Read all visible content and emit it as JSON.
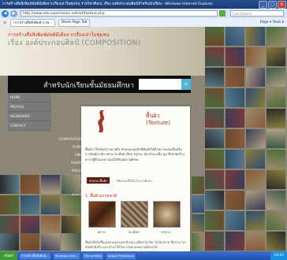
{
  "window": {
    "title": "การสร้างสื่อสิ่งพิมพ์มัลติมีเดียจากเรื่องเล่าในชุมชน รายวิชาศิลปะ เรื่อง องค์ประกอบศิลป์สำหรับนักเรียน - Windows Internet Explorer",
    "minimize": "_",
    "maximize": "□",
    "close": "×"
  },
  "address": {
    "url": "http://www.edu-supervision.net/art/texture.php",
    "search_placeholder": "Live Search"
  },
  "tabs": {
    "tab1": "การสร้างสื่อสิ่งพิมพ์ ภาพ...",
    "tab2": "Blank Page Tab",
    "tools": "Page ▾  Tools ▾"
  },
  "site": {
    "header_line1": "การสร้างสื่อสิ่งพิมพ์มัลติมีเดียจากเรื่องเล่าในชุมชน",
    "header_line2": "เรื่อง องค์ประกอบศิลป์ (COMPOSITION)",
    "band_title": "สำหรับนักเรียนชั้นมัธยมศึกษา",
    "search_icon": "search-icon",
    "nav": [
      "HOME",
      "PROFILE",
      "WEBBOARD",
      "CONTACT"
    ],
    "menu": [
      "COMPOSITION",
      "FORM",
      "LINE",
      "SHAPE",
      "VALUE",
      "COLOR",
      "TEXTURE",
      "SPACE"
    ]
  },
  "article": {
    "title": "พื้นผิว",
    "title_en": "(Texture)",
    "paragraph": "พื้นผิว (Texture) หมายถึง ลักษณะของผิวที่สัมผัสได้ด้วยการมองเห็นหรือการสัมผัส เช่น หยาบ ละเอียด เรียบ ขรุขระ มัน ด้าน แข็ง นุ่ม ซึ่งช่วยสร้างความรู้สึกและอารมณ์ให้กับผลงานศิลปะ",
    "subhead": "ลักษณะพื้นผิว",
    "subtext": "ชนิดของพื้นผิวในงานศิลปะ",
    "section": "1. พื้นผิวธรรมชาติ",
    "captions": [
      "หยาบ",
      "ละเอียด",
      "ขรุขระ"
    ],
    "bottom": "พื้นผิวที่เกิดขึ้นเองตามธรรมชาติ เช่น เปลือกไม้ หิน ใบไม้ ทราย ซึ่งสามารถสัมผัสได้จริง และนำมาใช้ในการออกแบบงานศิลปะได้"
  },
  "taskbar": {
    "start": "start",
    "items": [
      "การสร้างสื่อสิ่งพิมพ์...",
      "Windows Live...",
      "Documents",
      "Adobe Photoshop"
    ],
    "clock": "10:42"
  },
  "colors": {
    "accent_red": "#d12b1c",
    "search_blue": "#4eb8d4",
    "panel_black": "#0d0d0d"
  }
}
